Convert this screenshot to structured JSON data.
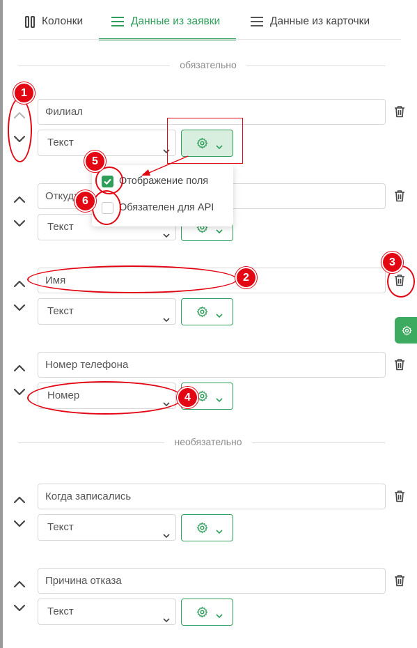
{
  "tabs": [
    {
      "label": "Колонки",
      "icon": "columns-icon",
      "active": false
    },
    {
      "label": "Данные из заявки",
      "icon": "list-icon",
      "active": true
    },
    {
      "label": "Данные из карточки",
      "icon": "list-icon",
      "active": false
    }
  ],
  "sections": {
    "required_label": "обязательно",
    "optional_label": "необязательно"
  },
  "fields": [
    {
      "name": "Филиал",
      "type": "Текст"
    },
    {
      "name": "Откуда",
      "type": "Текст"
    },
    {
      "name": "Имя",
      "type": "Текст"
    },
    {
      "name": "Номер телефона",
      "type": "Номер"
    },
    {
      "name": "Когда записались",
      "type": "Текст"
    },
    {
      "name": "Причина отказа",
      "type": "Текст"
    }
  ],
  "popup": {
    "show_field_label": "Отображение поля",
    "show_field_checked": true,
    "required_api_label": "Обязателен для API",
    "required_api_checked": false
  },
  "annotations": {
    "badge_1": "1",
    "badge_2": "2",
    "badge_3": "3",
    "badge_4": "4",
    "badge_5": "5",
    "badge_6": "6"
  },
  "colors": {
    "accent": "#2f9e5b",
    "annotation": "#e30613"
  }
}
